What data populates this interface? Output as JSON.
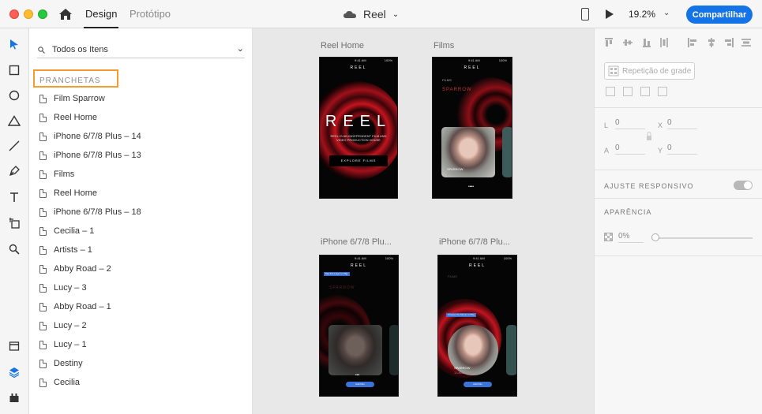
{
  "app": {
    "tabs": [
      "Design",
      "Protótipo"
    ],
    "document": "Reel",
    "zoom": "19.2%",
    "share": "Compartilhar"
  },
  "toolbar": {
    "tools": [
      "select-icon",
      "rectangle-icon",
      "ellipse-icon",
      "polygon-icon",
      "line-icon",
      "pen-icon",
      "text-icon",
      "artboard-icon",
      "zoom-icon",
      "assets-icon",
      "layers-icon",
      "plugins-icon"
    ]
  },
  "layers": {
    "filter": "Todos os Itens",
    "section": "PRANCHETAS",
    "items": [
      "Film Sparrow",
      "Reel Home",
      "iPhone 6/7/8 Plus – 14",
      "iPhone 6/7/8 Plus – 13",
      "Films",
      "Reel Home",
      "iPhone 6/7/8 Plus – 18",
      "Cecilia – 1",
      "Artists – 1",
      "Abby Road – 2",
      "Lucy – 3",
      "Abby Road – 1",
      "Lucy – 2",
      "Lucy – 1",
      "Destiny",
      "Cecilia"
    ]
  },
  "canvas": {
    "artboards": [
      {
        "title": "Reel Home",
        "heading": "REEL",
        "nav": "REEL",
        "tagline": "REEL IS AN INDEPENDENT FILM AND VIDEO PRODUCTION HOUSE",
        "button": "EXPLORE FILMS",
        "time": "9:41 AM",
        "battery": "100%"
      },
      {
        "title": "Films",
        "section": "FILMS",
        "heading": "SPARROW",
        "nav": "REEL",
        "card_label": "SPARROW",
        "card_meta": "1 LIKE",
        "time": "9:41 AM",
        "battery": "100%"
      },
      {
        "title": "iPhone 6/7/8 Plu...",
        "overlay": "Tap this Layer to Play",
        "heading": "SPARROW",
        "nav": "REEL",
        "button": "Add Film",
        "time": "9:41 AM",
        "battery": "100%"
      },
      {
        "title": "iPhone 6/7/8 Plu...",
        "section": "FILMS",
        "overlay": "Choose the Movie to Play",
        "card_label": "SPARROW",
        "card_meta": "1 LIKE",
        "nav": "REEL",
        "button": "Add Film",
        "time": "9:41 AM",
        "battery": "100%"
      }
    ]
  },
  "properties": {
    "repeat_grid": "Repetição de grade",
    "w_label": "L",
    "w": "0",
    "h_label": "A",
    "h": "0",
    "x_label": "X",
    "x": "0",
    "y_label": "Y",
    "y": "0",
    "responsive": "AJUSTE RESPONSIVO",
    "responsive_on": true,
    "appearance": "APARÊNCIA",
    "opacity": "0%",
    "opacity_value": 0
  },
  "colors": {
    "accent": "#1473e6",
    "highlight": "#f39c32",
    "artboard_bg": "#050505",
    "swirl": "#b5121b"
  }
}
